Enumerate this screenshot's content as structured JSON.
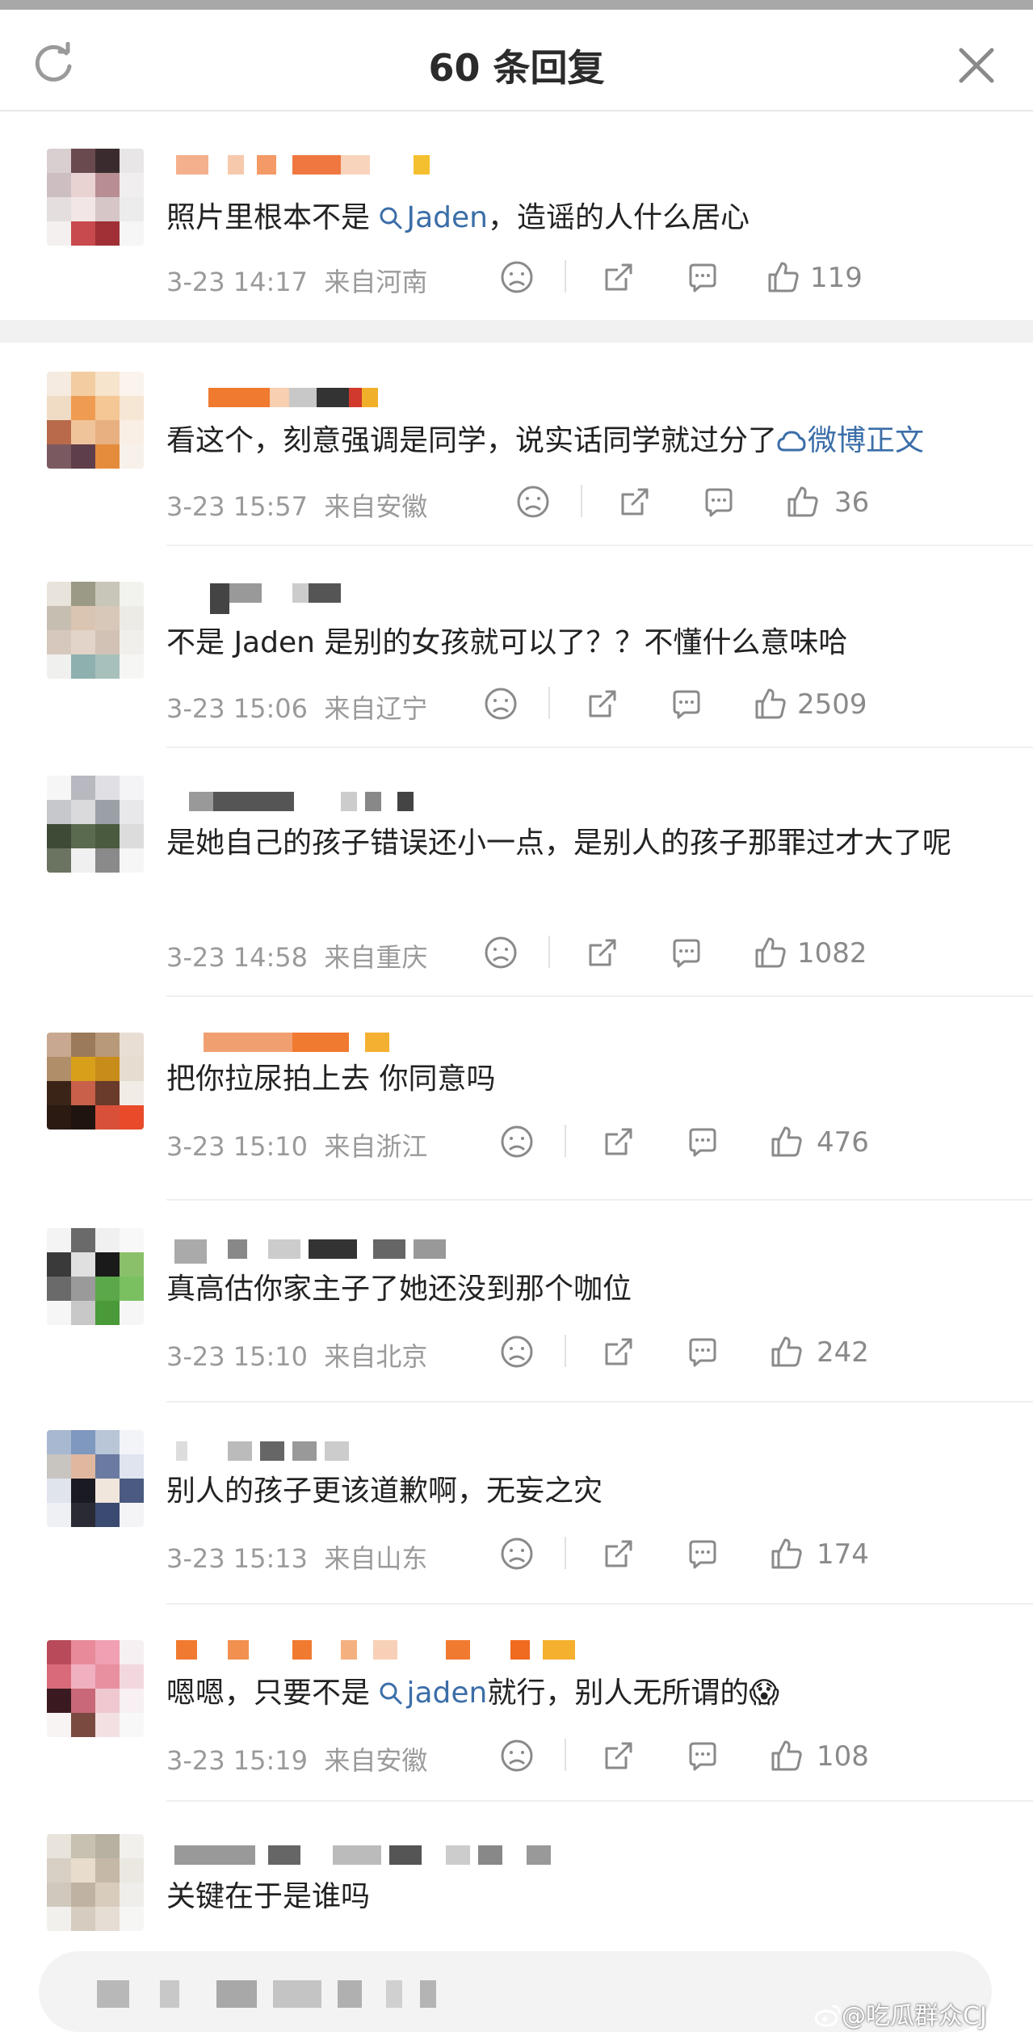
{
  "header": {
    "title": "60 条回复"
  },
  "comments": [
    {
      "text_before": "照片里根本不是 ",
      "mention": "Jaden",
      "text_after": "，造谣的人什么居心",
      "time": "3-23 14:17",
      "location": "来自河南",
      "likes": "119"
    },
    {
      "text_before": "看这个，刻意强调是同学，说实话同学就过分了",
      "link": "微博正文",
      "time": "3-23 15:57",
      "location": "来自安徽",
      "likes": "36"
    },
    {
      "text": "不是 Jaden 是别的女孩就可以了？？不懂什么意味哈",
      "time": "3-23 15:06",
      "location": "来自辽宁",
      "likes": "2509"
    },
    {
      "text": "是她自己的孩子错误还小一点，是别人的孩子那罪过才大了呢",
      "time": "3-23 14:58",
      "location": "来自重庆",
      "likes": "1082"
    },
    {
      "text": "把你拉尿拍上去 你同意吗",
      "time": "3-23 15:10",
      "location": "来自浙江",
      "likes": "476"
    },
    {
      "text": "真高估你家主子了她还没到那个咖位",
      "time": "3-23 15:10",
      "location": "来自北京",
      "likes": "242"
    },
    {
      "text": "别人的孩子更该道歉啊，无妄之灾",
      "time": "3-23 15:13",
      "location": "来自山东",
      "likes": "174"
    },
    {
      "text_before": "嗯嗯，只要不是 ",
      "mention": "jaden",
      "text_after": "就行，别人无所谓的",
      "emoji": "😱",
      "time": "3-23 15:19",
      "location": "来自安徽",
      "likes": "108"
    },
    {
      "text": "关键在于是谁吗"
    }
  ],
  "watermark": "@吃瓜群众CJ",
  "colors": {
    "mention": "#3b6ea8",
    "meta": "#9a9a9a",
    "text": "#222222",
    "separator": "#f1f1f1"
  },
  "icons": [
    "refresh-icon",
    "close-icon",
    "search-icon",
    "link-icon",
    "dislike-icon",
    "share-icon",
    "reply-icon",
    "like-icon",
    "weibo-logo-icon"
  ]
}
